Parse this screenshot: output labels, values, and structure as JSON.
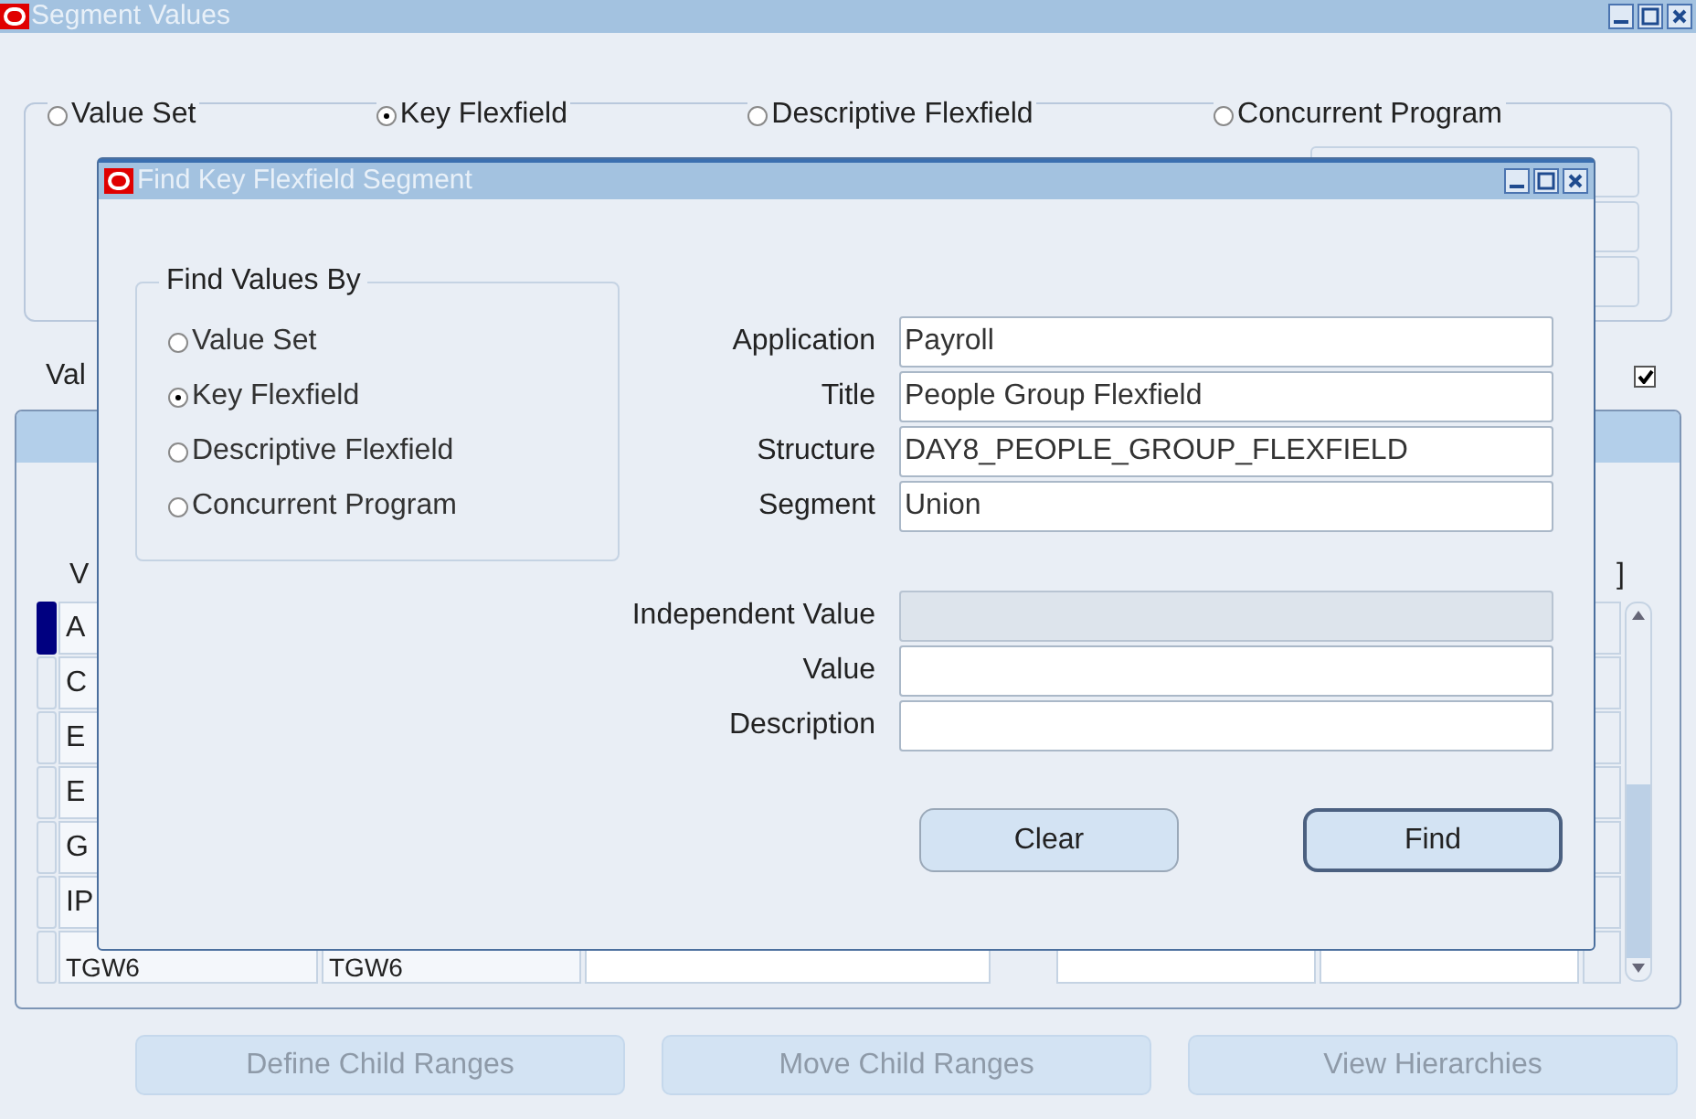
{
  "window": {
    "title": "Segment Values"
  },
  "find_by": [
    {
      "label": "Value Set",
      "selected": false
    },
    {
      "label": "Key Flexfield",
      "selected": true
    },
    {
      "label": "Descriptive Flexfield",
      "selected": false
    },
    {
      "label": "Concurrent Program",
      "selected": false
    }
  ],
  "values_label": "Val",
  "values_checkbox": {
    "checked": true
  },
  "table": {
    "columns": [
      "V",
      "]"
    ],
    "rows": [
      {
        "column_1": "A",
        "selected": true
      },
      {
        "column_1": "C",
        "selected": false
      },
      {
        "column_1": "E",
        "selected": false
      },
      {
        "column_1": "E",
        "selected": false
      },
      {
        "column_1": "G",
        "selected": false
      },
      {
        "column_1": "IP",
        "selected": false
      },
      {
        "column_1": "TGW6",
        "column_2": "TGW6",
        "selected": false
      }
    ]
  },
  "buttons": [
    {
      "label": "Define Child Ranges",
      "disabled": true
    },
    {
      "label": "Move Child Ranges",
      "disabled": true
    },
    {
      "label": "View Hierarchies",
      "disabled": true
    }
  ],
  "dialog": {
    "title": "Find Key Flexfield Segment",
    "group_title": "Find Values By",
    "find_by": [
      {
        "label": "Value Set",
        "selected": false
      },
      {
        "label": "Key Flexfield",
        "selected": true
      },
      {
        "label": "Descriptive Flexfield",
        "selected": false
      },
      {
        "label": "Concurrent Program",
        "selected": false
      }
    ],
    "fields": [
      {
        "label": "Application",
        "value": "Payroll",
        "disabled": false
      },
      {
        "label": "Title",
        "value": "People Group Flexfield",
        "disabled": false
      },
      {
        "label": "Structure",
        "value": "DAY8_PEOPLE_GROUP_FLEXFIELD",
        "disabled": false
      },
      {
        "label": "Segment",
        "value": "Union",
        "disabled": false
      }
    ],
    "search_fields": [
      {
        "label": "Independent Value",
        "disabled": true
      },
      {
        "label": "Value",
        "disabled": false
      },
      {
        "label": "Description",
        "disabled": false
      }
    ],
    "buttons": [
      {
        "label": "Clear",
        "default": false
      },
      {
        "label": "Find",
        "default": true
      }
    ]
  }
}
